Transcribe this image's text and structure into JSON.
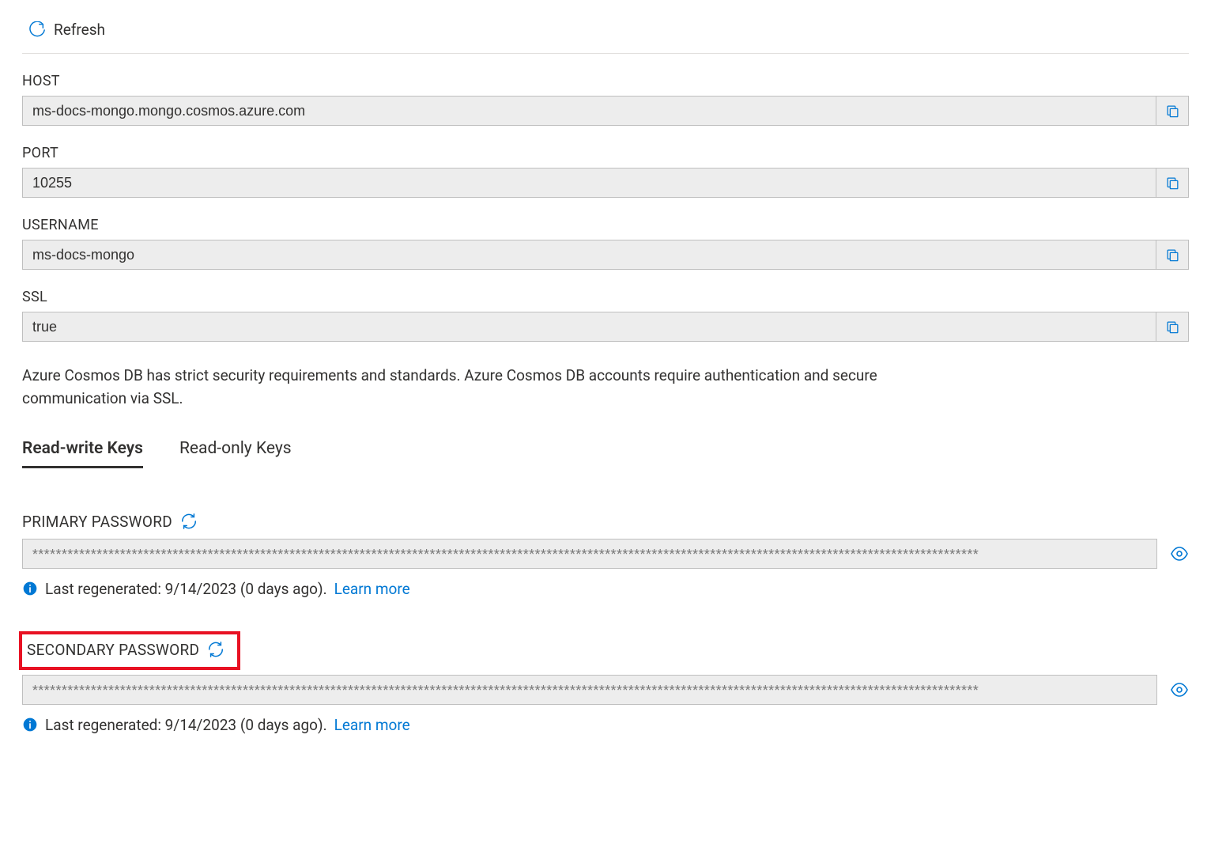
{
  "toolbar": {
    "refresh_label": "Refresh"
  },
  "fields": {
    "host": {
      "label": "HOST",
      "value": "ms-docs-mongo.mongo.cosmos.azure.com"
    },
    "port": {
      "label": "PORT",
      "value": "10255"
    },
    "username": {
      "label": "USERNAME",
      "value": "ms-docs-mongo"
    },
    "ssl": {
      "label": "SSL",
      "value": "true"
    }
  },
  "note_text": "Azure Cosmos DB has strict security requirements and standards. Azure Cosmos DB accounts require authentication and secure communication via SSL.",
  "tabs": {
    "read_write": "Read-write Keys",
    "read_only": "Read-only Keys"
  },
  "passwords": {
    "primary": {
      "label": "PRIMARY PASSWORD",
      "masked": "******************************************************************************************************************************************************************",
      "last_regenerated": "Last regenerated: 9/14/2023 (0 days ago).",
      "learn_more": "Learn more"
    },
    "secondary": {
      "label": "SECONDARY PASSWORD",
      "masked": "******************************************************************************************************************************************************************",
      "last_regenerated": "Last regenerated: 9/14/2023 (0 days ago).",
      "learn_more": "Learn more"
    }
  }
}
